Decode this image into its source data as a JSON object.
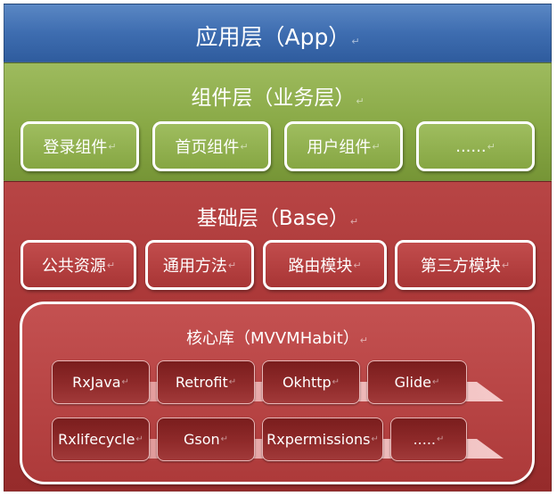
{
  "app_layer": {
    "title": "应用层（App）",
    "mark": "↵"
  },
  "component_layer": {
    "title": "组件层（业务层）",
    "mark": "↵",
    "components": [
      {
        "label": "登录组件",
        "mark": "↵"
      },
      {
        "label": "首页组件",
        "mark": "↵"
      },
      {
        "label": "用户组件",
        "mark": "↵"
      },
      {
        "label": "......",
        "mark": "↵"
      }
    ]
  },
  "base_layer": {
    "title": "基础层（Base）",
    "mark": "↵",
    "modules": [
      {
        "label": "公共资源",
        "mark": "↵"
      },
      {
        "label": "通用方法",
        "mark": "↵"
      },
      {
        "label": "路由模块",
        "mark": "↵"
      },
      {
        "label": "第三方模块",
        "mark": "↵"
      }
    ],
    "core": {
      "title": "核心库（MVVMHabit）",
      "mark": "↵",
      "row1": [
        {
          "label": "RxJava",
          "mark": "↵"
        },
        {
          "label": "Retrofit",
          "mark": "↵"
        },
        {
          "label": "Okhttp",
          "mark": "↵"
        },
        {
          "label": "Glide",
          "mark": "↵"
        }
      ],
      "row2": [
        {
          "label": "Rxlifecycle",
          "mark": "↵"
        },
        {
          "label": "Gson",
          "mark": "↵"
        },
        {
          "label": "Rxpermissions",
          "mark": "↵"
        },
        {
          "label": ".....",
          "mark": "↵"
        }
      ]
    }
  },
  "colors": {
    "app": "#3e6db0",
    "component": "#88a845",
    "base": "#a93636",
    "lib": "#8f2a2a"
  }
}
